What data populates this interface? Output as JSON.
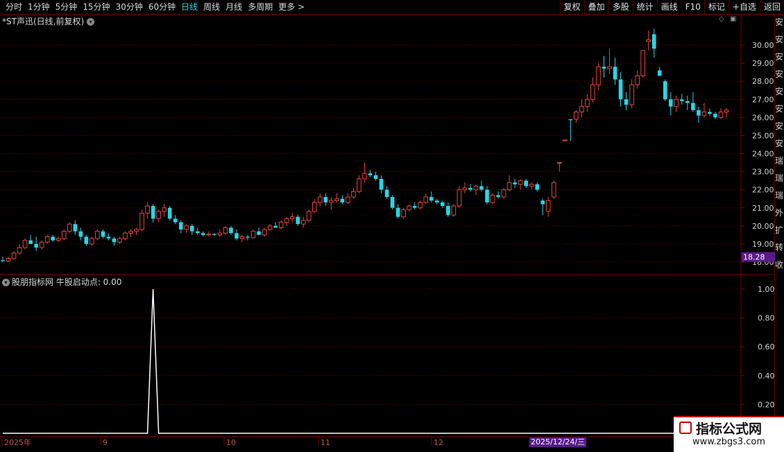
{
  "toolbar": {
    "periods": [
      "分时",
      "1分钟",
      "5分钟",
      "15分钟",
      "30分钟",
      "60分钟",
      "日线",
      "周线",
      "月线",
      "多周期",
      "更多 >"
    ],
    "active_index": 6,
    "right_buttons": [
      "复权",
      "叠加",
      "多股",
      "统计",
      "画线",
      "F10",
      "标记",
      "+自选",
      "返回"
    ]
  },
  "main_chart": {
    "title": "*ST声迅(日线,前复权)",
    "price_axis_ticks": [
      "30.00",
      "29.00",
      "28.00",
      "27.00",
      "26.00",
      "25.00",
      "24.00",
      "23.00",
      "22.00",
      "21.00",
      "20.00",
      "19.00",
      "18.00"
    ],
    "current_price_label": "18.28"
  },
  "indicator": {
    "title": "股朋指标网 牛股启动点: 0.00",
    "axis_ticks": [
      "1.00",
      "0.80",
      "0.60",
      "0.40",
      "0.20"
    ]
  },
  "time_axis": {
    "labels": [
      "2025年",
      "9",
      "10",
      "11",
      "12"
    ],
    "highlight_date": "2025/12/24/三"
  },
  "right_strip_chars": [
    "安",
    "安",
    "安",
    "安",
    "安",
    "安",
    "安",
    "安",
    "瑞",
    "瑞",
    "瑞",
    "外",
    "扩",
    "转",
    "收"
  ],
  "watermark": {
    "title": "指标公式网",
    "url": "www.zbgs3.com"
  },
  "colors": {
    "up": "#e8463c",
    "down": "#27d6e6",
    "grid": "#7a0000",
    "line": "#ffffff",
    "tag": "#5a1a8a"
  },
  "chart_data": {
    "type": "candlestick",
    "title": "*ST声迅(日线,前复权)",
    "ylim": [
      17.6,
      31.0
    ],
    "yticks": [
      18,
      19,
      20,
      21,
      22,
      23,
      24,
      25,
      26,
      27,
      28,
      29,
      30
    ],
    "candles": [
      [
        18.1,
        18.3,
        18.0,
        18.05
      ],
      [
        18.05,
        18.3,
        18.0,
        18.2
      ],
      [
        18.2,
        18.6,
        18.1,
        18.5
      ],
      [
        18.5,
        19.0,
        18.4,
        18.8
      ],
      [
        18.8,
        19.3,
        18.7,
        19.2
      ],
      [
        19.2,
        19.5,
        19.0,
        19.0
      ],
      [
        19.0,
        19.4,
        18.6,
        18.8
      ],
      [
        18.8,
        19.2,
        18.7,
        19.1
      ],
      [
        19.1,
        19.5,
        19.0,
        19.4
      ],
      [
        19.4,
        19.5,
        19.1,
        19.2
      ],
      [
        19.2,
        19.4,
        19.1,
        19.3
      ],
      [
        19.3,
        19.8,
        19.2,
        19.7
      ],
      [
        19.7,
        20.2,
        19.6,
        20.1
      ],
      [
        20.1,
        20.3,
        19.5,
        19.7
      ],
      [
        19.7,
        19.9,
        19.2,
        19.4
      ],
      [
        19.4,
        19.5,
        18.9,
        19.0
      ],
      [
        19.0,
        19.4,
        18.9,
        19.3
      ],
      [
        19.3,
        19.8,
        19.2,
        19.7
      ],
      [
        19.7,
        19.8,
        19.3,
        19.4
      ],
      [
        19.4,
        19.6,
        19.2,
        19.3
      ],
      [
        19.3,
        19.4,
        18.9,
        19.1
      ],
      [
        19.1,
        19.4,
        19.0,
        19.3
      ],
      [
        19.3,
        19.7,
        19.2,
        19.6
      ],
      [
        19.6,
        19.8,
        19.4,
        19.7
      ],
      [
        19.7,
        19.9,
        19.5,
        19.8
      ],
      [
        19.8,
        20.9,
        19.7,
        20.7
      ],
      [
        20.7,
        21.3,
        20.4,
        21.1
      ],
      [
        21.1,
        21.2,
        20.2,
        20.4
      ],
      [
        20.4,
        20.9,
        20.2,
        20.8
      ],
      [
        20.8,
        21.2,
        20.5,
        21.0
      ],
      [
        21.0,
        21.1,
        20.3,
        20.4
      ],
      [
        20.4,
        20.6,
        20.1,
        20.2
      ],
      [
        20.2,
        20.3,
        19.6,
        19.8
      ],
      [
        19.8,
        20.1,
        19.6,
        20.0
      ],
      [
        20.0,
        20.1,
        19.5,
        19.7
      ],
      [
        19.7,
        19.9,
        19.5,
        19.6
      ],
      [
        19.6,
        19.7,
        19.4,
        19.5
      ],
      [
        19.5,
        19.7,
        19.4,
        19.55
      ],
      [
        19.55,
        19.6,
        19.45,
        19.5
      ],
      [
        19.5,
        19.8,
        19.4,
        19.6
      ],
      [
        19.6,
        20.0,
        19.5,
        19.9
      ],
      [
        19.9,
        20.0,
        19.5,
        19.6
      ],
      [
        19.6,
        19.8,
        19.2,
        19.3
      ],
      [
        19.3,
        19.5,
        19.1,
        19.4
      ],
      [
        19.4,
        19.5,
        19.2,
        19.35
      ],
      [
        19.35,
        19.8,
        19.3,
        19.7
      ],
      [
        19.7,
        19.9,
        19.5,
        19.5
      ],
      [
        19.5,
        19.9,
        19.4,
        19.8
      ],
      [
        19.8,
        20.1,
        19.7,
        20.0
      ],
      [
        20.0,
        20.2,
        19.9,
        19.9
      ],
      [
        19.9,
        20.3,
        19.8,
        20.2
      ],
      [
        20.2,
        20.5,
        20.0,
        20.4
      ],
      [
        20.4,
        20.7,
        20.2,
        20.5
      ],
      [
        20.5,
        20.6,
        20.0,
        20.1
      ],
      [
        20.1,
        20.5,
        19.9,
        20.3
      ],
      [
        20.3,
        20.9,
        20.2,
        20.8
      ],
      [
        20.8,
        21.5,
        20.7,
        21.3
      ],
      [
        21.3,
        21.8,
        21.1,
        21.6
      ],
      [
        21.6,
        21.8,
        21.1,
        21.3
      ],
      [
        21.3,
        21.6,
        20.9,
        21.4
      ],
      [
        21.4,
        21.8,
        21.3,
        21.5
      ],
      [
        21.5,
        21.7,
        21.2,
        21.3
      ],
      [
        21.3,
        21.8,
        21.2,
        21.6
      ],
      [
        21.6,
        22.1,
        21.5,
        21.9
      ],
      [
        21.9,
        22.8,
        21.8,
        22.6
      ],
      [
        22.6,
        23.5,
        22.4,
        22.9
      ],
      [
        22.9,
        23.1,
        22.7,
        22.8
      ],
      [
        22.8,
        23.0,
        22.5,
        22.6
      ],
      [
        22.6,
        22.8,
        21.8,
        22.0
      ],
      [
        22.0,
        22.2,
        21.5,
        21.6
      ],
      [
        21.6,
        21.7,
        20.9,
        21.0
      ],
      [
        21.0,
        21.2,
        20.4,
        20.5
      ],
      [
        20.5,
        21.0,
        20.4,
        20.9
      ],
      [
        20.9,
        21.2,
        20.8,
        21.1
      ],
      [
        21.1,
        21.3,
        20.9,
        21.0
      ],
      [
        21.0,
        21.4,
        20.9,
        21.3
      ],
      [
        21.3,
        21.8,
        21.2,
        21.6
      ],
      [
        21.6,
        21.9,
        21.3,
        21.4
      ],
      [
        21.4,
        21.5,
        21.2,
        21.3
      ],
      [
        21.3,
        21.4,
        21.0,
        21.1
      ],
      [
        21.1,
        21.3,
        20.5,
        20.6
      ],
      [
        20.6,
        21.2,
        20.5,
        21.1
      ],
      [
        21.1,
        22.2,
        21.0,
        22.0
      ],
      [
        22.0,
        22.4,
        21.8,
        22.1
      ],
      [
        22.1,
        22.3,
        21.9,
        22.0
      ],
      [
        22.0,
        22.3,
        21.7,
        22.2
      ],
      [
        22.2,
        22.5,
        21.9,
        22.0
      ],
      [
        22.0,
        22.2,
        21.2,
        21.3
      ],
      [
        21.3,
        21.8,
        21.2,
        21.7
      ],
      [
        21.7,
        21.9,
        21.5,
        21.6
      ],
      [
        21.6,
        22.1,
        21.5,
        22.0
      ],
      [
        22.0,
        22.8,
        21.9,
        22.4
      ],
      [
        22.4,
        22.6,
        22.1,
        22.3
      ],
      [
        22.3,
        22.6,
        22.0,
        22.5
      ],
      [
        22.5,
        22.6,
        22.1,
        22.2
      ],
      [
        22.2,
        22.4,
        22.0,
        22.3
      ],
      [
        22.3,
        22.4,
        21.9,
        22.0
      ],
      [
        21.4,
        21.5,
        20.6,
        21.2
      ],
      [
        20.8,
        21.6,
        20.5,
        21.4
      ],
      [
        21.6,
        22.5,
        21.5,
        22.4
      ],
      [
        23.5,
        23.5,
        23.0,
        23.5
      ],
      [
        24.7,
        24.8,
        24.7,
        24.75
      ],
      [
        25.9,
        25.9,
        24.7,
        25.85
      ],
      [
        25.9,
        26.4,
        25.7,
        26.3
      ],
      [
        26.3,
        27.0,
        26.0,
        26.6
      ],
      [
        26.6,
        27.3,
        26.3,
        27.0
      ],
      [
        27.0,
        28.2,
        26.8,
        27.8
      ],
      [
        27.8,
        29.0,
        27.5,
        28.8
      ],
      [
        28.8,
        29.4,
        28.2,
        28.7
      ],
      [
        28.7,
        29.8,
        28.4,
        28.8
      ],
      [
        28.8,
        29.3,
        27.8,
        28.1
      ],
      [
        28.1,
        28.5,
        26.6,
        27.0
      ],
      [
        27.0,
        27.4,
        26.4,
        26.7
      ],
      [
        26.7,
        28.1,
        26.5,
        27.8
      ],
      [
        27.8,
        28.6,
        27.6,
        28.3
      ],
      [
        28.3,
        29.7,
        28.2,
        29.7
      ],
      [
        30.2,
        30.8,
        29.7,
        30.3
      ],
      [
        30.6,
        30.9,
        29.3,
        29.8
      ],
      [
        28.6,
        28.8,
        28.3,
        28.3
      ],
      [
        28.0,
        28.1,
        26.9,
        27.0
      ],
      [
        27.0,
        27.4,
        26.1,
        26.6
      ],
      [
        26.6,
        27.2,
        26.3,
        27.0
      ],
      [
        27.0,
        27.3,
        26.7,
        26.9
      ],
      [
        26.9,
        27.2,
        26.4,
        26.8
      ],
      [
        26.8,
        27.4,
        26.3,
        26.4
      ],
      [
        26.4,
        26.6,
        25.7,
        26.1
      ],
      [
        26.1,
        26.8,
        26.0,
        26.3
      ],
      [
        26.3,
        26.5,
        26.1,
        26.2
      ],
      [
        26.2,
        26.3,
        25.9,
        26.0
      ],
      [
        26.0,
        26.5,
        25.9,
        26.3
      ],
      [
        26.3,
        26.5,
        26.0,
        26.4
      ]
    ],
    "indicator": {
      "name": "牛股启动点",
      "ylim": [
        0,
        1.0
      ],
      "spike_index": 27,
      "spike_value": 1.0
    }
  }
}
